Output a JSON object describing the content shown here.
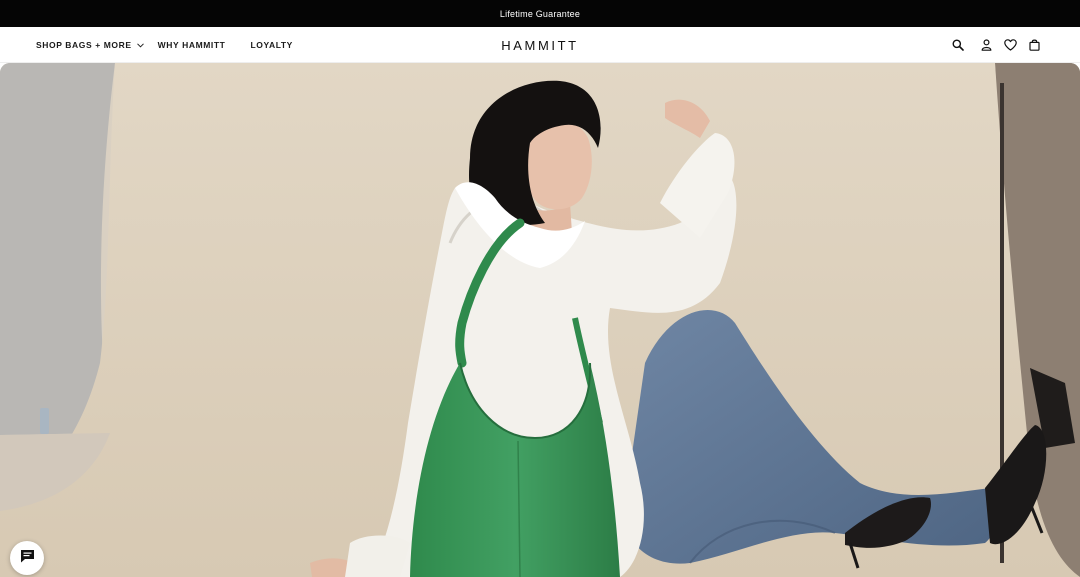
{
  "announcement": {
    "text": "Lifetime Guarantee"
  },
  "header": {
    "nav": [
      {
        "label": "SHOP BAGS + MORE",
        "has_dropdown": true
      },
      {
        "label": "WHY HAMMITT",
        "has_dropdown": false
      },
      {
        "label": "LOYALTY",
        "has_dropdown": false
      }
    ],
    "logo": "HAMMITT",
    "icons": [
      "search-icon",
      "account-icon",
      "wishlist-heart-icon",
      "cart-bag-icon"
    ]
  },
  "hero": {
    "image": "woman in white shirt and jeans sitting with green leather shoulder bag"
  },
  "chat": {
    "icon": "chat-icon"
  },
  "colors": {
    "announcement_bg": "#050505",
    "bag_green": "#3d9a5a",
    "backdrop": "#e3d9c8"
  }
}
